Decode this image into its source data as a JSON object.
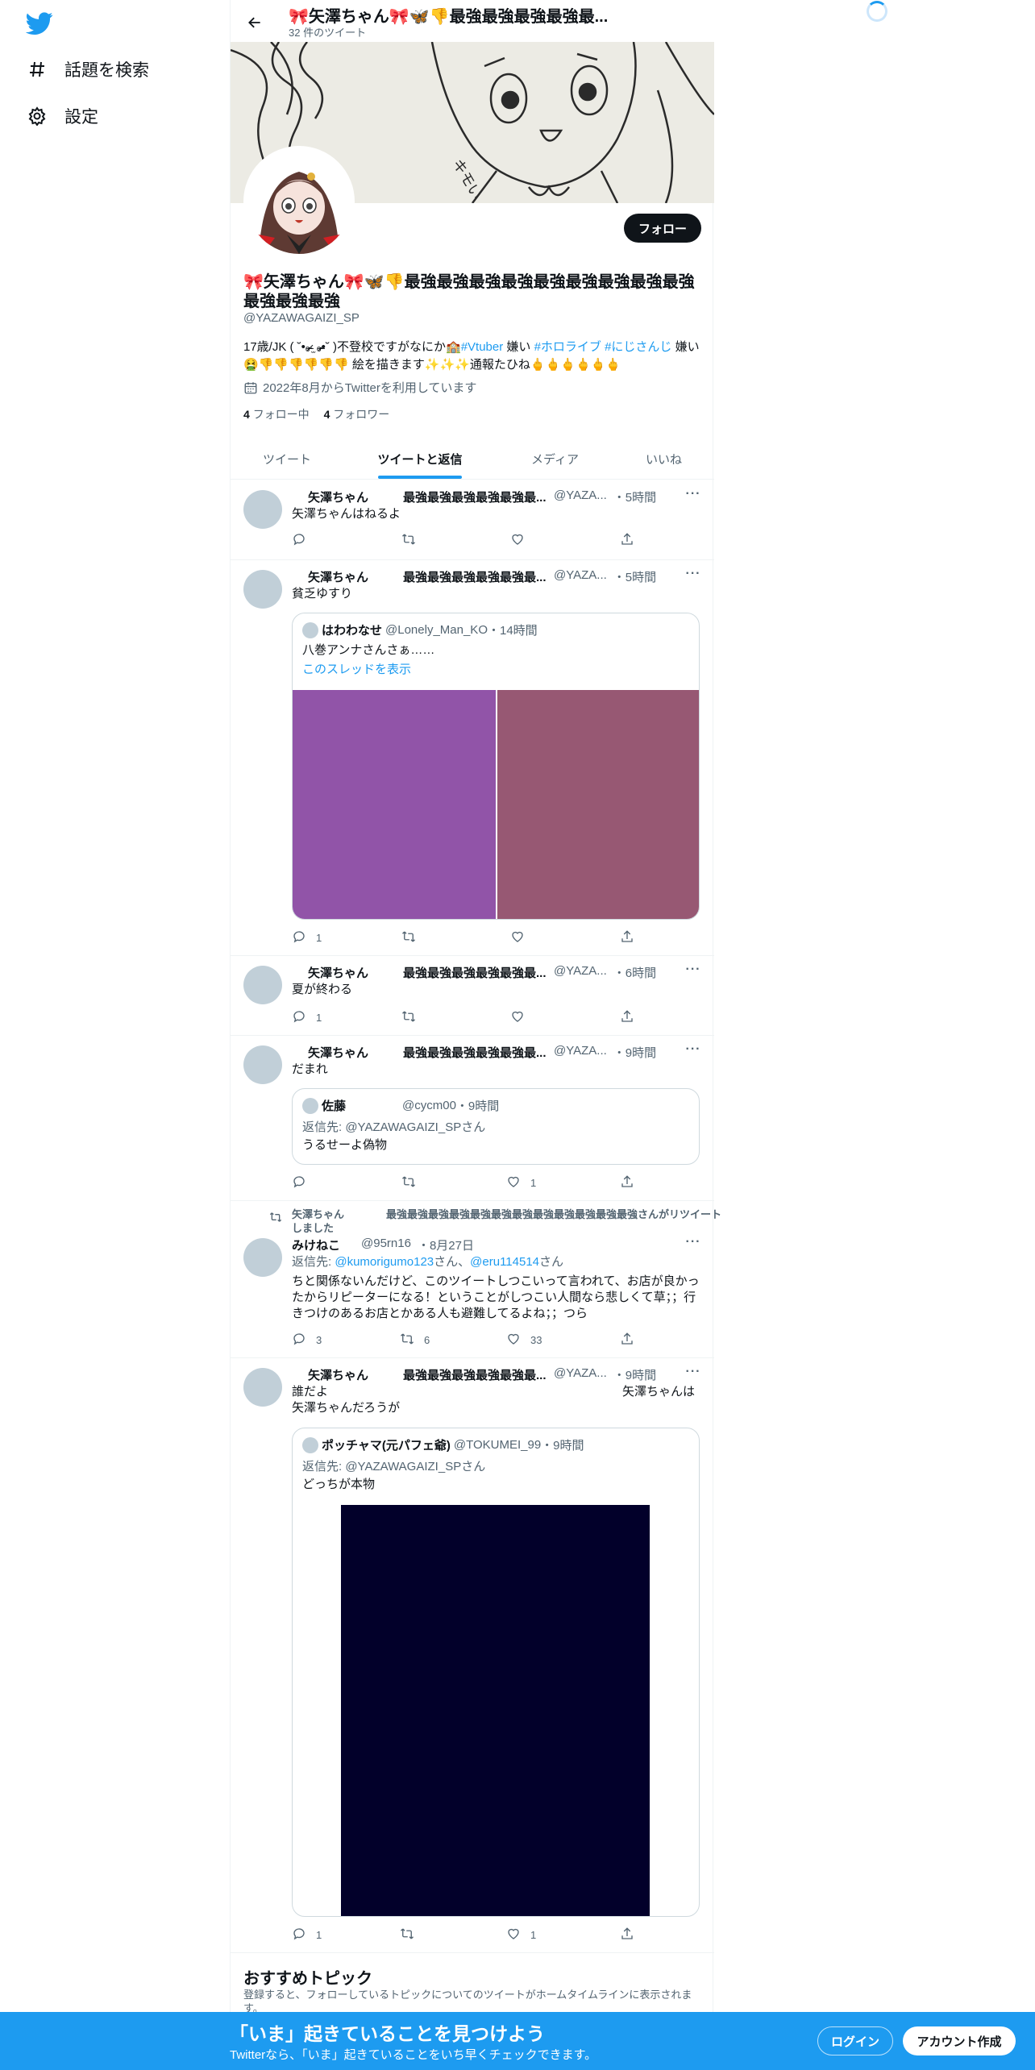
{
  "sidebar": {
    "items": [
      {
        "icon": "hashtag-icon",
        "label": "話題を検索"
      },
      {
        "icon": "gear-icon",
        "label": "設定"
      }
    ]
  },
  "header": {
    "title": "🎀矢澤ちゃん🎀🦋👎最強最強最強最強最...",
    "tweet_count": "32 件のツイート"
  },
  "profile": {
    "follow_label": "フォロー",
    "name": "🎀矢澤ちゃん🎀🦋👎最強最強最強最強最強最強最強最強最強最強最強最強",
    "handle": "@YAZAWAGAIZI_SP",
    "bio_a": "17歳/JK ( ˘•ₒ̴̶̷ ̫ ₒ̴̶̷•˘ )不登校ですがなにか🏫",
    "bio_tag1": "#Vtuber",
    "bio_b": " 嫌い ",
    "bio_tag2": "#ホロライブ",
    "bio_c": " ",
    "bio_tag3": "#にじさんじ",
    "bio_d": " 嫌い🤮👎👎👎👎👎👎 絵を描きます✨✨✨通報たひね🖕🖕🖕🖕🖕🖕",
    "joined": "2022年8月からTwitterを利用しています",
    "following_count": "4",
    "following_label": "フォロー中",
    "followers_count": "4",
    "followers_label": "フォロワー"
  },
  "tabs": [
    "ツイート",
    "ツイートと返信",
    "メディア",
    "いいね"
  ],
  "tweets": [
    {
      "name": "矢澤ちゃん",
      "name2": "最強最強最強最強最強最...",
      "handle": "@YAZA...",
      "time": "・5時間",
      "text": "矢澤ちゃんはねるよ",
      "reply": "",
      "retweet": "",
      "like": ""
    },
    {
      "name": "矢澤ちゃん",
      "name2": "最強最強最強最強最強最...",
      "handle": "@YAZA...",
      "time": "・5時間",
      "text": "貧乏ゆすり",
      "reply": "1",
      "retweet": "",
      "like": "",
      "quote": {
        "name": "はわわなせ",
        "handle": "@Lonely_Man_KO",
        "time": "・14時間",
        "text": "八巻アンナさんさぁ……",
        "link": "このスレッドを表示",
        "colors": [
          "#9154a8",
          "#975873"
        ]
      }
    },
    {
      "name": "矢澤ちゃん",
      "name2": "最強最強最強最強最強最...",
      "handle": "@YAZA...",
      "time": "・6時間",
      "text": "夏が終わる",
      "reply": "1",
      "retweet": "",
      "like": ""
    },
    {
      "name": "矢澤ちゃん",
      "name2": "最強最強最強最強最強最...",
      "handle": "@YAZA...",
      "time": "・9時間",
      "text": "だまれ",
      "reply": "",
      "retweet": "",
      "like": "1",
      "quote": {
        "name": "佐藤",
        "handle": "@cycm00",
        "time": "・9時間",
        "reply_to": "返信先: @YAZAWAGAIZI_SPさん",
        "text": "うるせーよ偽物"
      }
    },
    {
      "retweet_label": "矢澤ちゃん　　　　最強最強最強最強最強最強最強最強最強最強最強最強さんがリツイートしました",
      "name": "みけねこ",
      "handle": "@95rn16",
      "time": "・8月27日",
      "reply_prefix": "返信先: ",
      "reply_user1": "@kumorigumo123",
      "reply_mid": "さん、",
      "reply_user2": "@eru114514",
      "reply_suffix": "さん",
      "text": "ちと関係ないんだけど、このツイートしつこいって言われて、お店が良かったからリピーターになる！ということがしつこい人間なら悲しくて草；；行きつけのあるお店とかある人も避難してるよね；；つら",
      "reply": "3",
      "retweet": "6",
      "like": "33"
    },
    {
      "name": "矢澤ちゃん",
      "name2": "最強最強最強最強最強最...",
      "handle": "@YAZA...",
      "time": "・9時間",
      "text_l1a": "誰だよ",
      "text_l1b": "矢澤ちゃんは",
      "text_l2": "矢澤ちゃんだろうが",
      "reply": "1",
      "retweet": "",
      "like": "1",
      "quote": {
        "name": "ポッチャマ(元パフェ爺)",
        "handle": "@TOKUMEI_99",
        "time": "・9時間",
        "reply_to": "返信先: @YAZAWAGAIZI_SPさん",
        "text": "どっちが本物",
        "media_color": "#02002a"
      }
    }
  ],
  "topics": {
    "title": "おすすめトピック",
    "desc": "登録すると、フォローしているトピックについてのツイートがホームタイムラインに表示されます。"
  },
  "bottom_bar": {
    "title": "「いま」起きていることを見つけよう",
    "subtitle": "Twitterなら、「いま」起きていることをいち早くチェックできます。",
    "login": "ログイン",
    "signup": "アカウント作成"
  },
  "colors": {
    "accent": "#1d9bf0",
    "text": "#0f1419",
    "secondary": "#536471"
  }
}
